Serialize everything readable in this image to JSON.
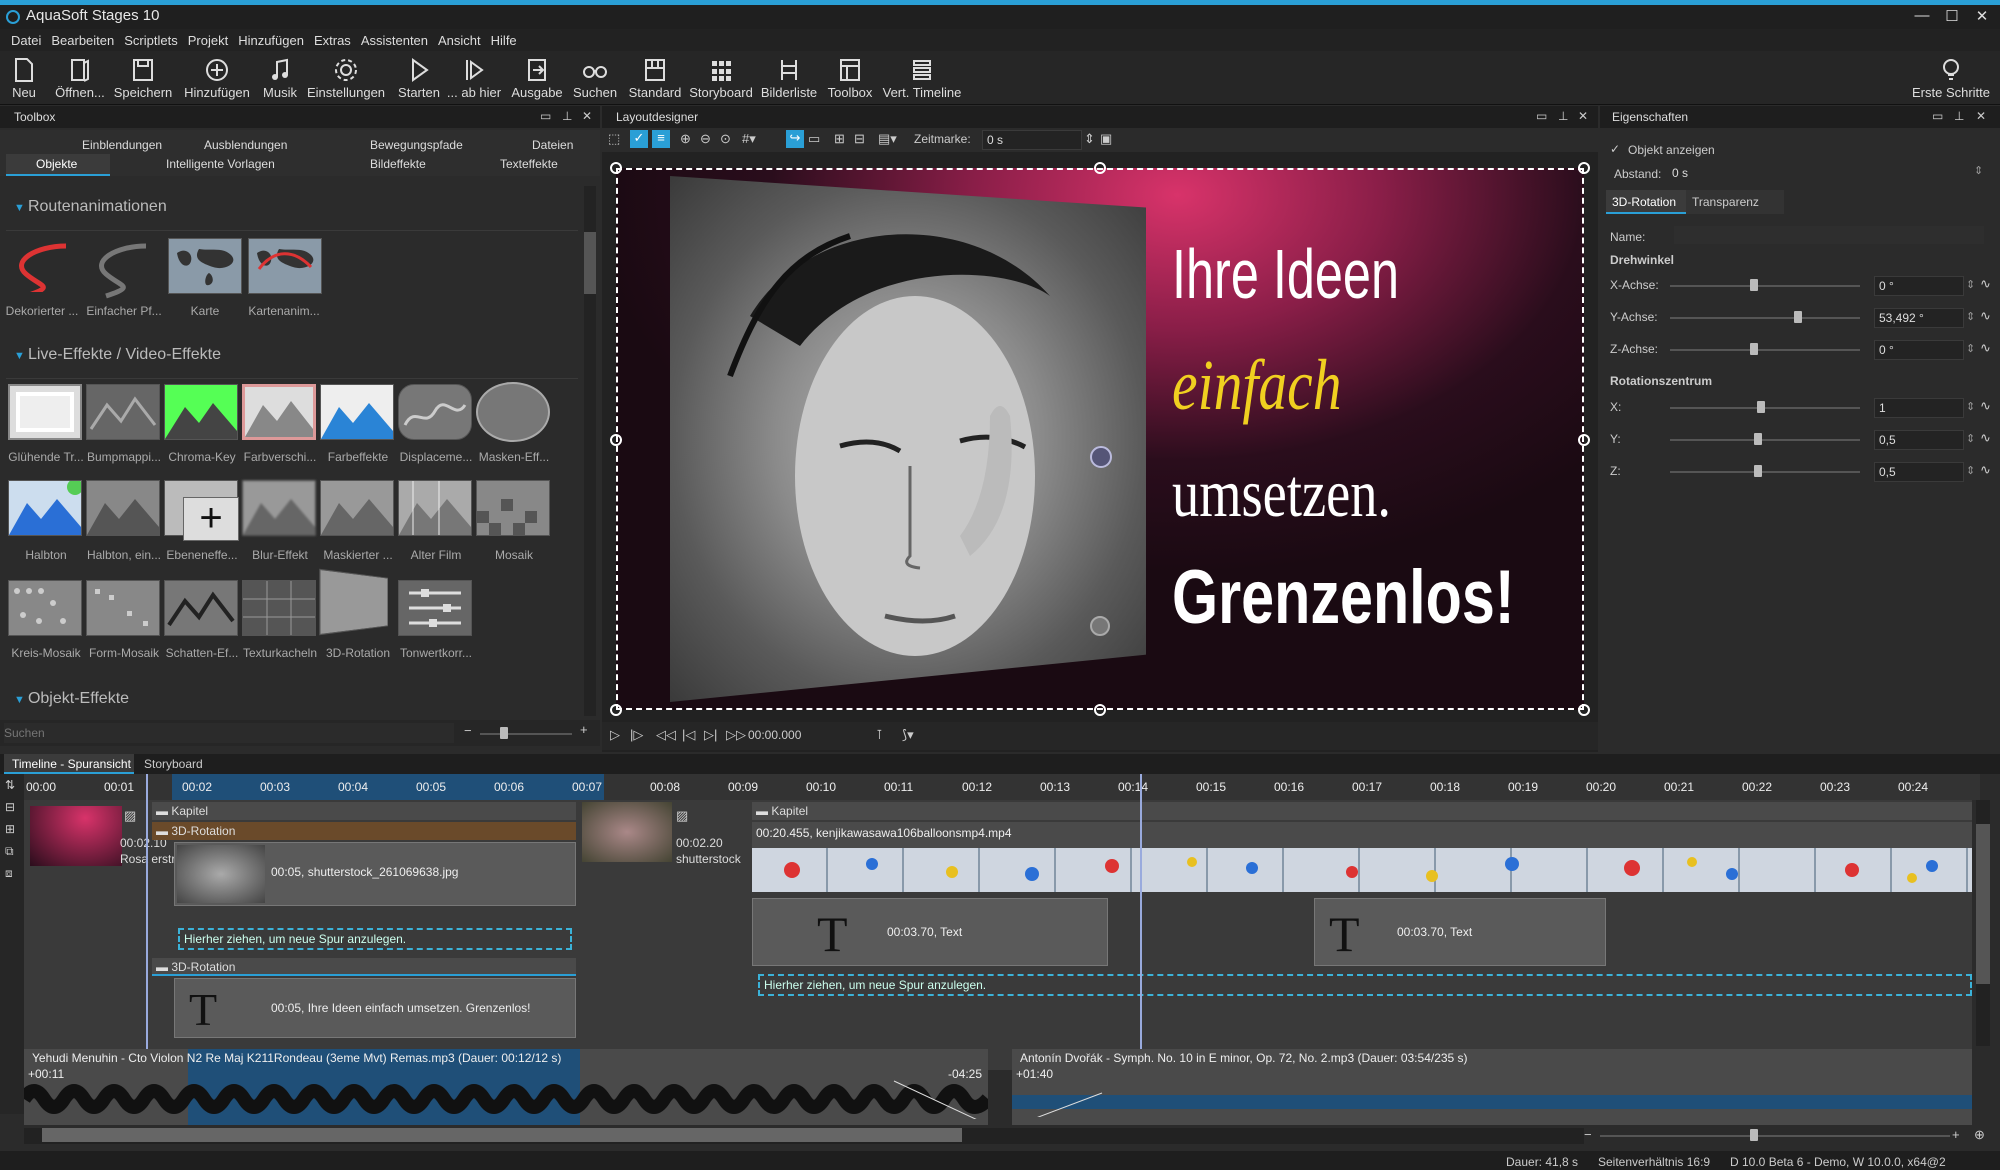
{
  "window": {
    "title": "AquaSoft Stages 10",
    "min": "—",
    "max": "☐",
    "close": "✕"
  },
  "menu": [
    "Datei",
    "Bearbeiten",
    "Scriptlets",
    "Projekt",
    "Hinzufügen",
    "Extras",
    "Assistenten",
    "Ansicht",
    "Hilfe"
  ],
  "toolbar": {
    "items": [
      "Neu",
      "Öffnen...",
      "Speichern",
      "Hinzufügen",
      "Musik",
      "Einstellungen",
      "Starten",
      "... ab hier",
      "Ausgabe",
      "Suchen",
      "Standard",
      "Storyboard",
      "Bilderliste",
      "Toolbox",
      "Vert. Timeline"
    ],
    "right": "Erste Schritte"
  },
  "toolbox": {
    "title": "Toolbox",
    "tabs_top": [
      "Einblendungen",
      "Ausblendungen",
      "Bewegungspfade",
      "Dateien"
    ],
    "tabs_bottom": [
      "Objekte",
      "Intelligente Vorlagen",
      "Bildeffekte",
      "Texteffekte"
    ],
    "sections": [
      "Routenanimationen",
      "Live-Effekte / Video-Effekte",
      "Objekt-Effekte"
    ],
    "route_items": [
      "Dekorierter ...",
      "Einfacher Pf...",
      "Karte",
      "Kartenanim..."
    ],
    "effects_row1": [
      "Glühende Tr...",
      "Bumpmappi...",
      "Chroma-Key",
      "Farbverschi...",
      "Farbeffekte",
      "Displaceme...",
      "Masken-Eff..."
    ],
    "effects_row2": [
      "Halbton",
      "Halbton, ein...",
      "Ebeneneffe...",
      "Blur-Effekt",
      "Maskierter ...",
      "Alter Film",
      "Mosaik"
    ],
    "effects_row3": [
      "Kreis-Mosaik",
      "Form-Mosaik",
      "Schatten-Ef...",
      "Texturkacheln",
      "3D-Rotation",
      "Tonwertkorr..."
    ],
    "search_placeholder": "Suchen"
  },
  "designer": {
    "title": "Layoutdesigner",
    "zeitmarke_label": "Zeitmarke:",
    "zeitmarke_value": "0 s",
    "time": "00:00.000",
    "slide_text": [
      "Ihre Ideen",
      "einfach",
      "umsetzen.",
      "Grenzenlos!"
    ],
    "colors": {
      "accent": "#f0d020",
      "pink": "#d6336c"
    }
  },
  "props": {
    "title": "Eigenschaften",
    "show_object": "Objekt anzeigen",
    "abstand_label": "Abstand:",
    "abstand_value": "0 s",
    "tabs": [
      "3D-Rotation",
      "Transparenz"
    ],
    "name_label": "Name:",
    "drehwinkel": "Drehwinkel",
    "axes": [
      {
        "label": "X-Achse:",
        "value": "0 °",
        "pos": 0.42
      },
      {
        "label": "Y-Achse:",
        "value": "53,492 °",
        "pos": 0.65
      },
      {
        "label": "Z-Achse:",
        "value": "0 °",
        "pos": 0.42
      }
    ],
    "rotcenter": "Rotationszentrum",
    "centers": [
      {
        "label": "X:",
        "value": "1",
        "pos": 0.46
      },
      {
        "label": "Y:",
        "value": "0,5",
        "pos": 0.44
      },
      {
        "label": "Z:",
        "value": "0,5",
        "pos": 0.44
      }
    ]
  },
  "timeline": {
    "tabs": [
      "Timeline - Spuransicht",
      "Storyboard"
    ],
    "ticks": [
      "00:00",
      "00:01",
      "00:02",
      "00:03",
      "00:04",
      "00:05",
      "00:06",
      "00:07",
      "00:08",
      "00:09",
      "00:10",
      "00:11",
      "00:12",
      "00:13",
      "00:14",
      "00:15",
      "00:16",
      "00:17",
      "00:18",
      "00:19",
      "00:20",
      "00:21",
      "00:22",
      "00:23",
      "00:24"
    ],
    "chapter": "Kapitel",
    "rot3d": "3D-Rotation",
    "clip_first_time": "00:02.10",
    "clip_first_name": "Rosa erstra",
    "clip_img": "00:05, shutterstock_261069638.jpg",
    "drop_hint": "Hierher ziehen, um neue Spur anzulegen.",
    "clip_text1": "00:05, Ihre Ideen einfach umsetzen. Grenzenlos!",
    "clip_photo_time": "00:02.20",
    "clip_photo_name": "shutterstock",
    "video": "00:20.455, kenjikawasawa106balloonsmp4.mp4",
    "text_clip": "00:03.70, Text",
    "audio1": "Yehudi Menuhin - Cto Violon N2 Re Maj K211Rondeau (3eme Mvt) Remas.mp3 (Dauer: 00:12/12 s)",
    "audio1_start": "+00:11",
    "audio1_end": "-04:25",
    "audio2": "Antonín Dvořák - Symph. No. 10 in E minor, Op. 72, No. 2.mp3 (Dauer: 03:54/235 s)",
    "audio2_start": "+01:40"
  },
  "status": {
    "dauer": "Dauer: 41,8 s",
    "ratio": "Seitenverhältnis 16:9",
    "version": "D 10.0 Beta 6 - Demo, W 10.0.0, x64@2"
  }
}
